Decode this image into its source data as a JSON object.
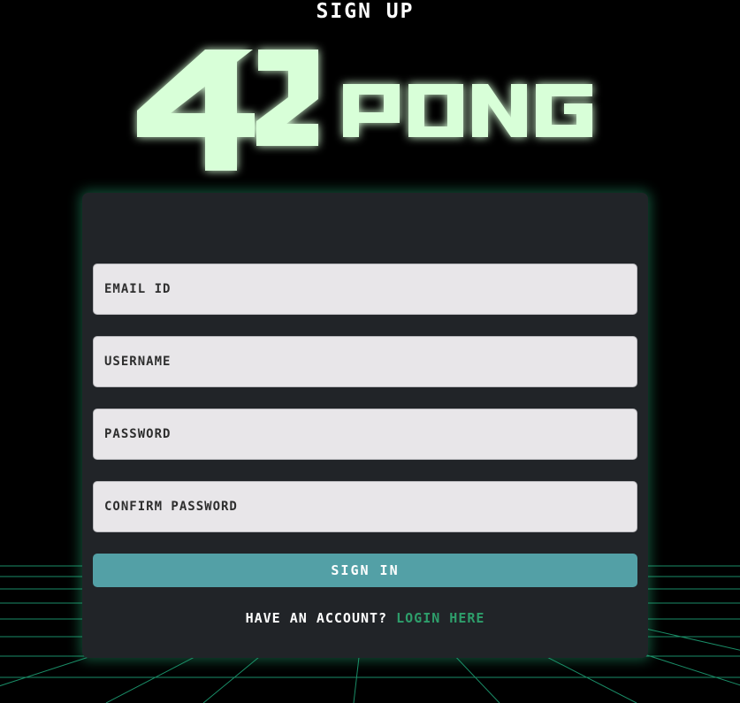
{
  "logo": {
    "number": "42",
    "word": "PONG",
    "color": "#d8ffd8",
    "glow": "#39ff39"
  },
  "form": {
    "title": "SIGN UP",
    "email_placeholder": "EMAIL ID",
    "username_placeholder": "USERNAME",
    "password_placeholder": "PASSWORD",
    "confirm_placeholder": "CONFIRM PASSWORD",
    "submit_label": "SIGN IN",
    "footer_text": "HAVE AN ACCOUNT? ",
    "login_link": "LOGIN HERE"
  },
  "colors": {
    "background": "#000000",
    "card": "#212428",
    "button": "#53a0a6",
    "link": "#2e9e6b",
    "grid": "#1fa67a"
  }
}
